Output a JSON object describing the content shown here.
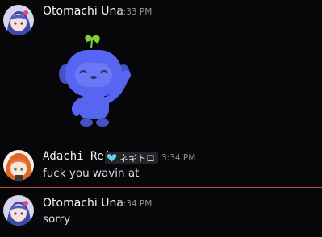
{
  "messages": [
    {
      "author": "Otomachi Una",
      "time": "3:33 PM",
      "attachment": "wumpus-sticker"
    },
    {
      "author": "Adachi Rei",
      "role_tag": "ネギトロ",
      "role_tag_color": "#5ed4e6",
      "time": "3:34 PM",
      "text": "fuck you wavin at"
    },
    {
      "author": "Otomachi Una",
      "time": "3:34 PM",
      "text": "sorry"
    }
  ],
  "colors": {
    "background": "#070709",
    "new_messages_divider": "#c0463d",
    "wumpus": "#5865f2"
  }
}
